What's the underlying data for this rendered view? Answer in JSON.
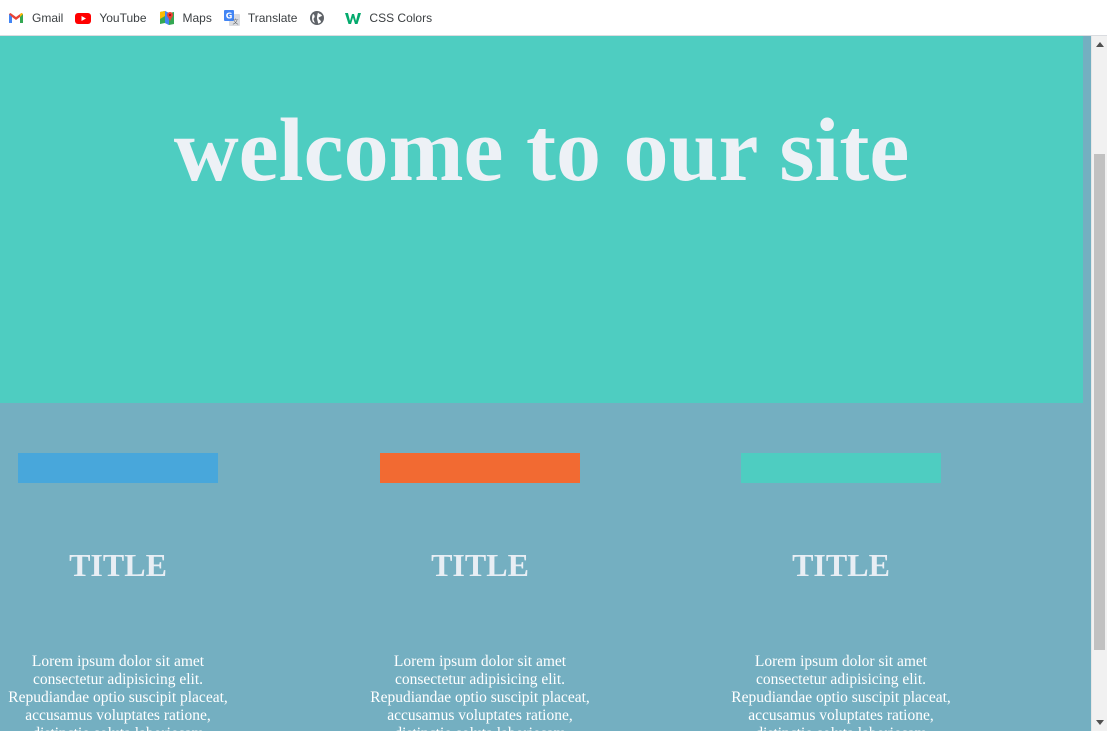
{
  "bookmarks": [
    {
      "label": "Gmail",
      "icon": "gmail-icon"
    },
    {
      "label": "YouTube",
      "icon": "youtube-icon"
    },
    {
      "label": "Maps",
      "icon": "maps-icon"
    },
    {
      "label": "Translate",
      "icon": "translate-icon"
    },
    {
      "label": "",
      "icon": "globe-icon"
    },
    {
      "label": "CSS Colors",
      "icon": "w3schools-icon"
    }
  ],
  "hero": {
    "title": "welcome to our site",
    "background": "#4ecdc1",
    "text_color": "#edf1f6"
  },
  "section": {
    "background": "#74afc1",
    "cards": [
      {
        "bar_color": "#48a7db",
        "title": "TITLE",
        "text": "Lorem ipsum dolor sit amet consectetur adipisicing elit. Repudiandae optio suscipit placeat, accusamus voluptates ratione, distinctio soluta laboriosam"
      },
      {
        "bar_color": "#f26a32",
        "title": "TITLE",
        "text": "Lorem ipsum dolor sit amet consectetur adipisicing elit. Repudiandae optio suscipit placeat, accusamus voluptates ratione, distinctio soluta laboriosam"
      },
      {
        "bar_color": "#4ecdc1",
        "title": "TITLE",
        "text": "Lorem ipsum dolor sit amet consectetur adipisicing elit. Repudiandae optio suscipit placeat, accusamus voluptates ratione, distinctio soluta laboriosam"
      }
    ]
  }
}
